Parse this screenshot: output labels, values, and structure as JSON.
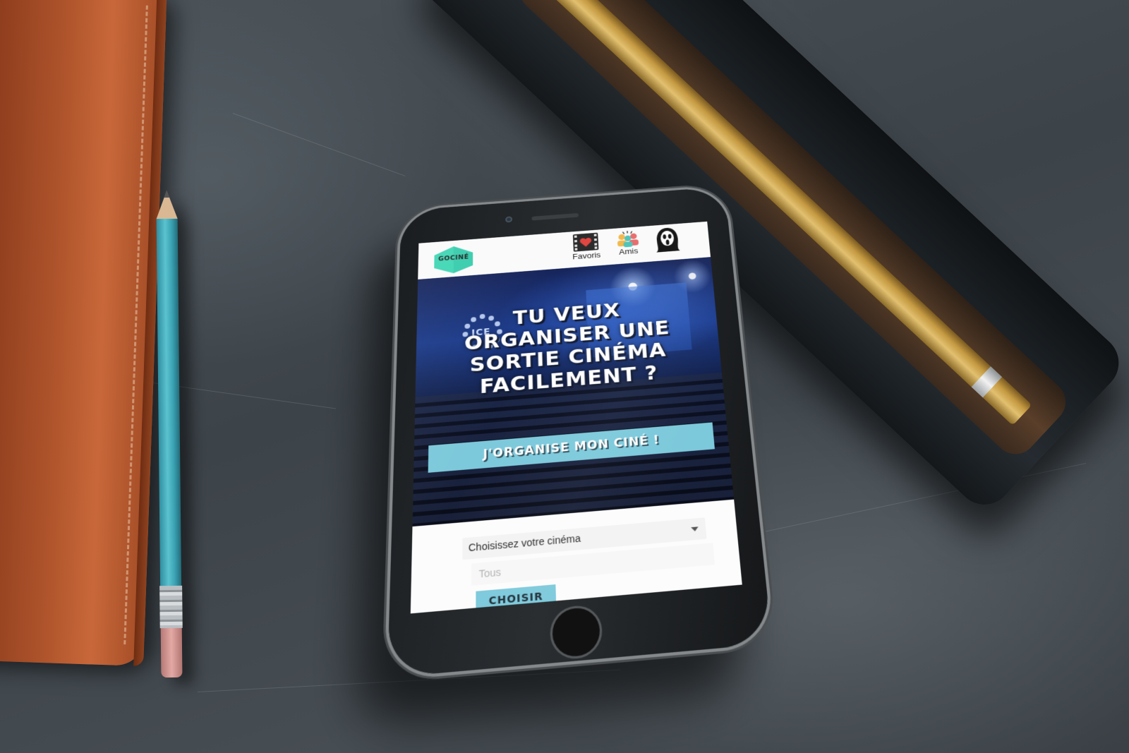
{
  "app": {
    "logo_text": "GOCINÉ",
    "nav": {
      "favoris_label": "Favoris",
      "amis_label": "Amis"
    }
  },
  "hero": {
    "watermark_text": "ICE",
    "headline": "TU VEUX ORGANISER UNE SORTIE CINÉMA FACILEMENT ?",
    "cta_label": "J'ORGANISE MON CINÉ !"
  },
  "form": {
    "cinema_select_label": "Choisissez votre cinéma",
    "cinema_input_placeholder": "Tous",
    "choose_button_label": "CHOISIR"
  },
  "colors": {
    "accent": "#7cc9db",
    "logo": "#3fd6b4"
  },
  "icons": [
    "film-heart-icon",
    "friends-icon",
    "ghostface-avatar-icon",
    "ice-logo-icon",
    "caret-down-icon"
  ]
}
